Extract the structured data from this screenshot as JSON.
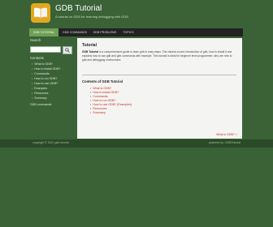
{
  "site": {
    "title": "GDB Tutorial",
    "subtitle": "A tutorial on GDB for learning debugging with GDB"
  },
  "nav": {
    "items": [
      {
        "label": "GDB TUTORIAL"
      },
      {
        "label": "GDB COMMANDS"
      },
      {
        "label": "GDB PROBLEMS"
      },
      {
        "label": "TOPICS"
      }
    ]
  },
  "sidebar": {
    "search_label": "Search",
    "contents_label": "Contents",
    "items": [
      {
        "label": "What is GDB?"
      },
      {
        "label": "How to install GDB?"
      },
      {
        "label": "Commands"
      },
      {
        "label": "How to run GDB?"
      },
      {
        "label": "How to use GDB?"
      },
      {
        "label": "Examples"
      },
      {
        "label": "Resources"
      },
      {
        "label": "Summary"
      }
    ],
    "extra": "GDB commands"
  },
  "content": {
    "title": "Tutorial",
    "desc_bold": "GDB Tutorial",
    "desc_rest": " is a comprehensive guide to learn gdb in easy steps. This tutorial covers introduction of gdb, how to install it and explains how to use gdb and gdb commands with example. This tutorial is ideal for beginner level programmer, who are new to gdb and debugging environment.",
    "toc_title": "Contents of GDB Tutorial",
    "toc": [
      {
        "label": "What is GDB?"
      },
      {
        "label": "How to install GDB?"
      },
      {
        "label": "Commands"
      },
      {
        "label": "How to run GDB?"
      },
      {
        "label": "How to use GDB? (Examples)"
      },
      {
        "label": "Resources"
      },
      {
        "label": "Summary"
      }
    ],
    "next_link": "What is GDB? >"
  },
  "footer": {
    "left": "copyright © 2021 gdb tutorial",
    "right": "powered by: GDBTutorial"
  },
  "colors": {
    "background": "#3a6236",
    "accent": "#6f9f54",
    "logo": "#e2a81d",
    "link": "#c62f24"
  }
}
